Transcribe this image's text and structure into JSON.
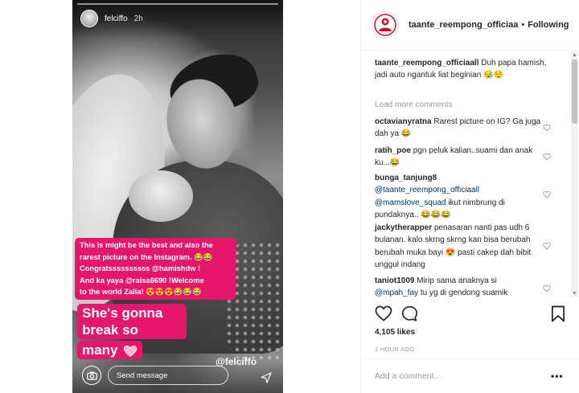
{
  "story": {
    "username": "felciffo",
    "time": "2h",
    "caption_lines": [
      "This is might be the best and also the",
      "rarest picture on the Instagram. 😂😂",
      "Congratssssssssss @hamishdw !",
      "And ka yaya @raisa6690 !Welcome",
      "to the world Zalia! 😍😍😍😂😂😂"
    ],
    "headline_line1": "She's gonna break so",
    "headline_line2": "many",
    "send_placeholder": "Send message",
    "watermark": "@felciffo"
  },
  "post": {
    "username": "taante_reempong_officiaa",
    "dot": "•",
    "follow_label": "Following",
    "comments": [
      {
        "user": "taante_reempong_officiaall",
        "text": "Duh papa hamish, jadi auto ngantuk liat beginian 😪😌"
      },
      {
        "user": "octavianyratna",
        "text": "Rarest picture on IG? Ga juga dah ya 😂"
      },
      {
        "user": "ratih_poe",
        "text": "pgn peluk kalian..suami dan anak ku...😂"
      },
      {
        "user": "bunga_tanjung8",
        "mention1": "@taante_reempong_officiaall",
        "mention2": "@mamslove_squad",
        "text": "ikut nimbrung di pundaknya.. 😂😂😂"
      },
      {
        "user": "jackytherapper",
        "text": "penasaran nanti pas udh 6 bulanan. kalo skrng skrng kan bisa berubah berubah muka bayi 😍 pasti cakep dah bibit unggul indang"
      },
      {
        "user": "taniot1009",
        "text": "Mirip sama anaknya si",
        "mention": "@mpah_fay",
        "text2": "tu yg di gendong suamik"
      }
    ],
    "load_more": "Load more comments",
    "likes": "4,105 likes",
    "time_ago": "1 HOUR AGO",
    "add_comment_placeholder": "Add a comment...",
    "more_label": "•••"
  },
  "icons": {
    "heart": "heart-icon",
    "comment": "comment-icon",
    "bookmark": "bookmark-icon",
    "camera": "camera-icon",
    "send": "send-icon"
  },
  "colors": {
    "caption_bg": "#e4176c",
    "mention": "#003569",
    "muted": "#999999"
  }
}
